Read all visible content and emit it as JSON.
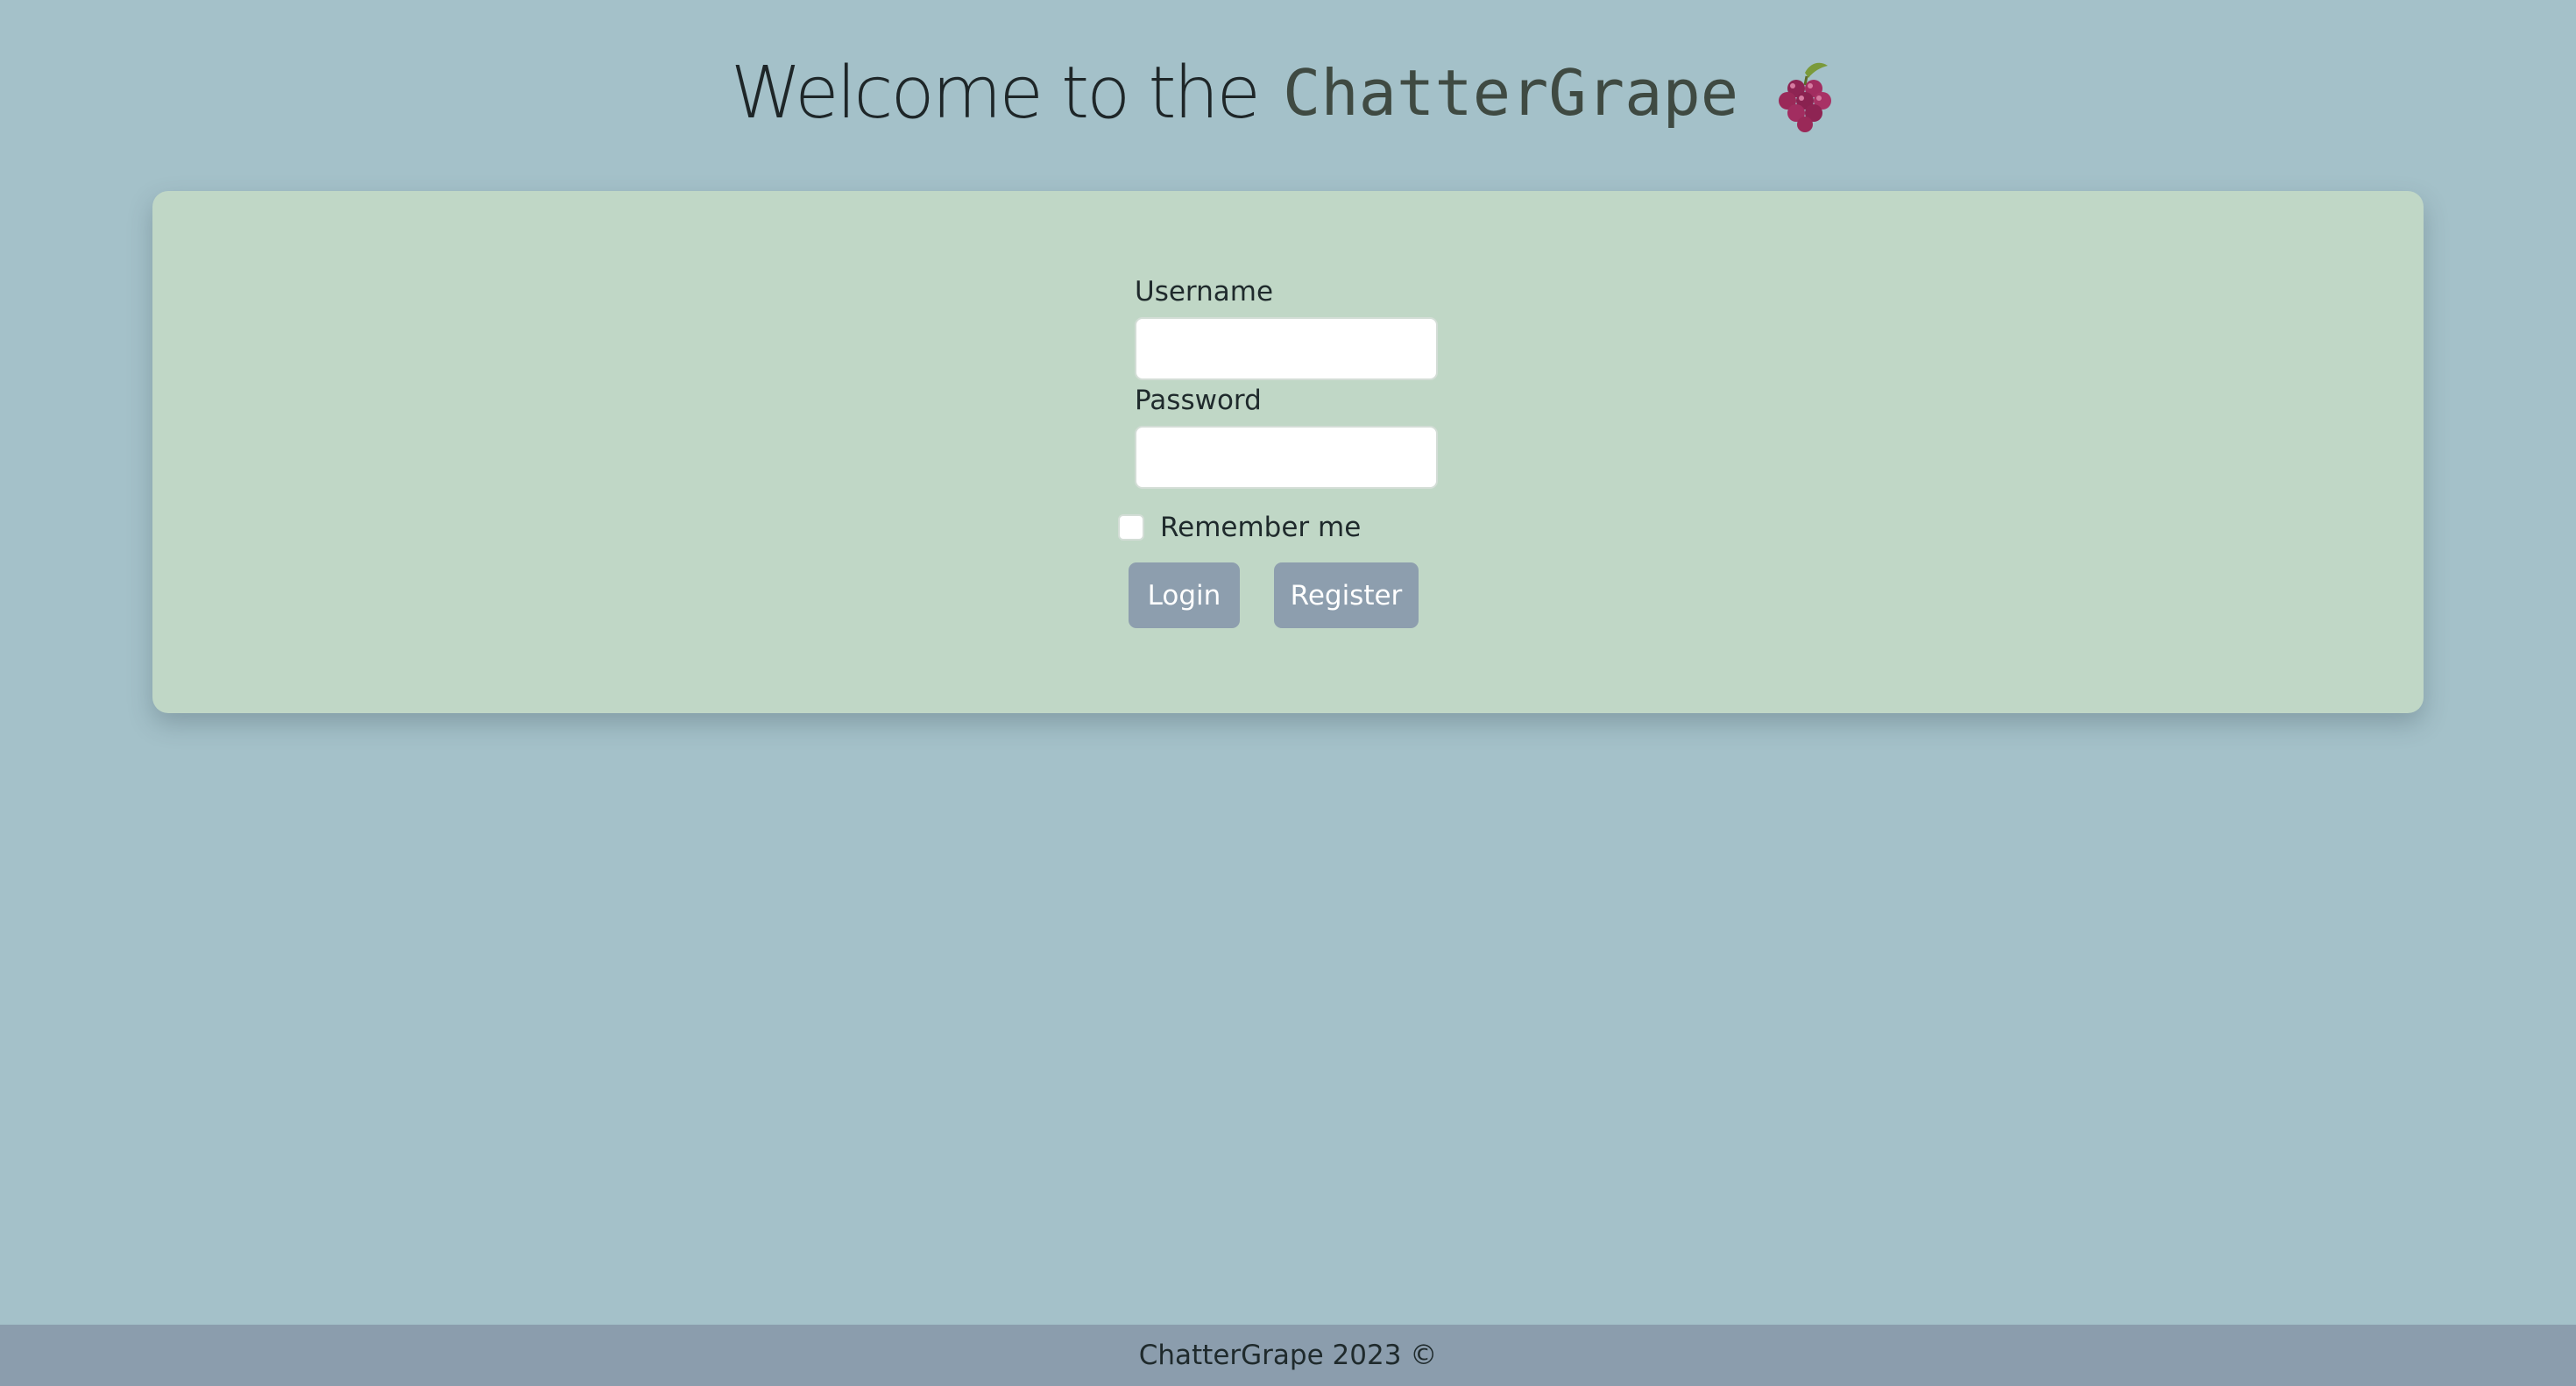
{
  "header": {
    "welcome_text": "Welcome to the",
    "brand_text": "ChatterGrape",
    "brand_icon": "grapes-icon"
  },
  "login_form": {
    "username_label": "Username",
    "username_value": "",
    "password_label": "Password",
    "password_value": "",
    "remember_label": "Remember me",
    "remember_checked": false,
    "login_label": "Login",
    "register_label": "Register"
  },
  "footer": {
    "text": "ChatterGrape 2023 ©"
  },
  "colors": {
    "page_background": "#a4c1c9",
    "card_background": "#c0d7c6",
    "button_background": "#8d9eae",
    "footer_background": "#8b9dad",
    "grape": "#9c2a5c"
  }
}
